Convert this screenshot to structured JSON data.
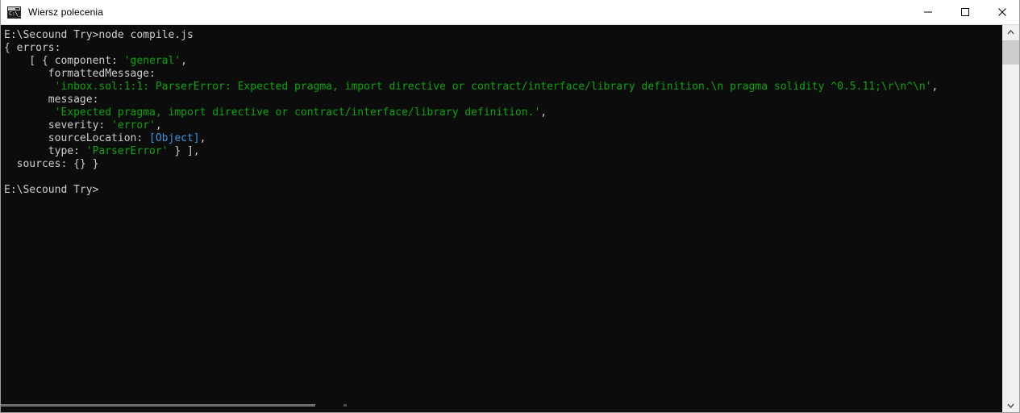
{
  "window": {
    "title": "Wiersz polecenia",
    "icon": "command-prompt-icon",
    "icon_glyph": "C:\\_",
    "background_color": "#0c0c0c",
    "titlebar_color": "#ffffff",
    "controls": {
      "minimize": "minimize-icon",
      "maximize": "maximize-icon",
      "close": "close-icon"
    }
  },
  "colors": {
    "text": "#cccccc",
    "string_green": "#0ca30c",
    "object_cyan": "#3a96dd",
    "scrollbar_track": "#f0f0f0",
    "scrollbar_thumb": "#cdcdcd"
  },
  "console": {
    "prompt": "E:\\Secound Try>",
    "command": "node compile.js",
    "lines": [
      {
        "id": "line-command",
        "segments": [
          {
            "text": "E:\\Secound Try>node compile.js",
            "color": "white"
          }
        ]
      },
      {
        "id": "line-errors-open",
        "segments": [
          {
            "text": "{ errors:",
            "color": "white"
          }
        ]
      },
      {
        "id": "line-component",
        "segments": [
          {
            "text": "    [ { component: ",
            "color": "white"
          },
          {
            "text": "'general'",
            "color": "green"
          },
          {
            "text": ",",
            "color": "white"
          }
        ]
      },
      {
        "id": "line-formattedmessage-key",
        "segments": [
          {
            "text": "       formattedMessage:",
            "color": "white"
          }
        ]
      },
      {
        "id": "line-formattedmessage-value",
        "segments": [
          {
            "text": "        ",
            "color": "white"
          },
          {
            "text": "'inbox.sol:1:1: ParserError: Expected pragma, import directive or contract/interface/library definition.\\n pragma solidity ^0.5.11;\\r\\n^\\n'",
            "color": "green"
          },
          {
            "text": ",",
            "color": "white"
          }
        ]
      },
      {
        "id": "line-message-key",
        "segments": [
          {
            "text": "       message:",
            "color": "white"
          }
        ]
      },
      {
        "id": "line-message-value",
        "segments": [
          {
            "text": "        ",
            "color": "white"
          },
          {
            "text": "'Expected pragma, import directive or contract/interface/library definition.'",
            "color": "green"
          },
          {
            "text": ",",
            "color": "white"
          }
        ]
      },
      {
        "id": "line-severity",
        "segments": [
          {
            "text": "       severity: ",
            "color": "white"
          },
          {
            "text": "'error'",
            "color": "green"
          },
          {
            "text": ",",
            "color": "white"
          }
        ]
      },
      {
        "id": "line-sourcelocation",
        "segments": [
          {
            "text": "       sourceLocation: ",
            "color": "white"
          },
          {
            "text": "[Object]",
            "color": "cyan"
          },
          {
            "text": ",",
            "color": "white"
          }
        ]
      },
      {
        "id": "line-type",
        "segments": [
          {
            "text": "       type: ",
            "color": "white"
          },
          {
            "text": "'ParserError'",
            "color": "green"
          },
          {
            "text": " } ],",
            "color": "white"
          }
        ]
      },
      {
        "id": "line-sources",
        "segments": [
          {
            "text": "  sources: {} }",
            "color": "white"
          }
        ]
      },
      {
        "id": "line-blank",
        "segments": [
          {
            "text": "",
            "color": "white"
          }
        ]
      },
      {
        "id": "line-prompt",
        "segments": [
          {
            "text": "E:\\Secound Try>",
            "color": "white"
          }
        ]
      }
    ]
  },
  "scrollbars": {
    "vertical": {
      "up_arrow": "chevron-up-icon",
      "down_arrow": "chevron-down-icon"
    },
    "horizontal": {
      "visible": true
    }
  }
}
